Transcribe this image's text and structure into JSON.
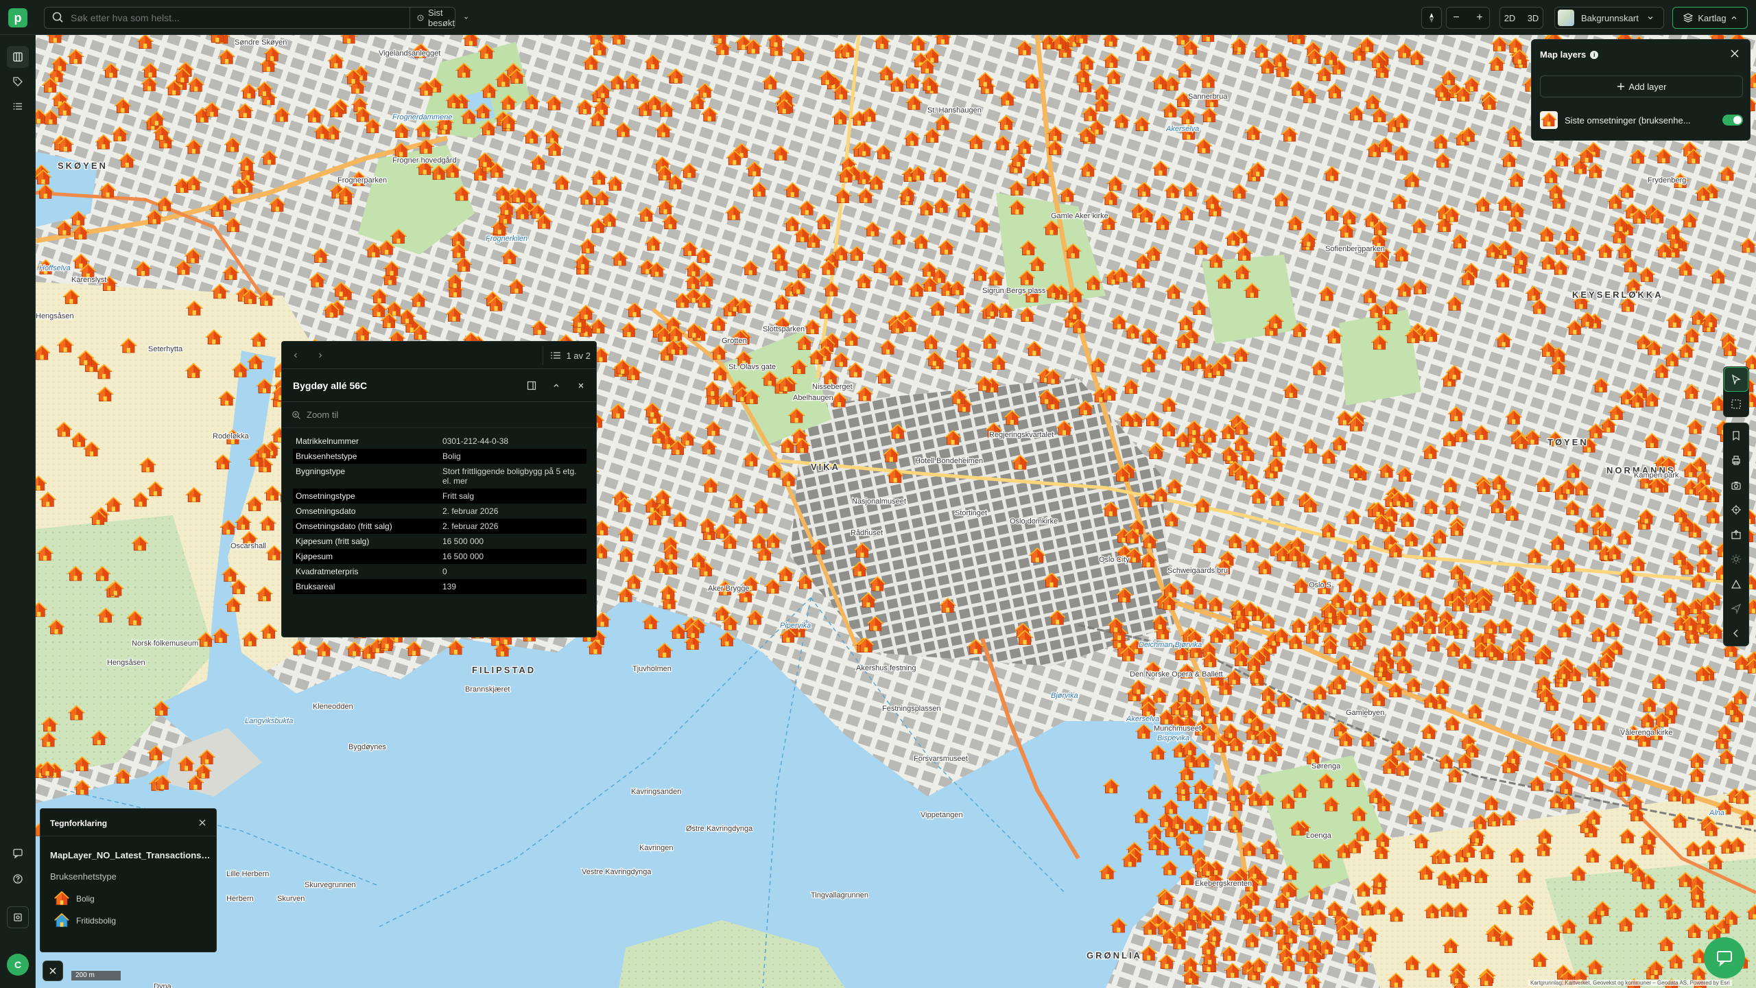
{
  "app": {
    "logo_letter": "p"
  },
  "search": {
    "placeholder": "Søk etter hva som helst...",
    "recent_label": "Sist besøkt"
  },
  "toolbar": {
    "compass_icon": "compass-icon",
    "zoom_out_label": "−",
    "zoom_in_label": "+",
    "view_2d_label": "2D",
    "view_3d_label": "3D",
    "basemap_label": "Bakgrunnskart",
    "layers_label": "Kartlag"
  },
  "sidebar": {
    "avatar_initial": "C"
  },
  "map_layers_panel": {
    "title": "Map layers",
    "add_layer_label": "Add layer",
    "layers": [
      {
        "name": "Siste omsetninger (bruksenhe...",
        "visible": true
      }
    ]
  },
  "popup": {
    "pager": "1 av 2",
    "title": "Bygdøy allé 56C",
    "zoom_to_label": "Zoom til",
    "attributes": [
      {
        "key": "Matrikkelnummer",
        "value": "0301-212-44-0-38"
      },
      {
        "key": "Bruksenhetstype",
        "value": "Bolig"
      },
      {
        "key": "Bygningstype",
        "value": "Stort frittliggende boligbygg på 5 etg. el. mer"
      },
      {
        "key": "Omsetningstype",
        "value": "Fritt salg"
      },
      {
        "key": "Omsetningsdato",
        "value": "2. februar 2026"
      },
      {
        "key": "Omsetningsdato (fritt salg)",
        "value": "2. februar 2026"
      },
      {
        "key": "Kjøpesum (fritt salg)",
        "value": "16 500 000"
      },
      {
        "key": "Kjøpesum",
        "value": "16 500 000"
      },
      {
        "key": "Kvadratmeterpris",
        "value": "0"
      },
      {
        "key": "Bruksareal",
        "value": "139"
      }
    ]
  },
  "legend": {
    "title": "Tegnforklaring",
    "layer_name": "MapLayer_NO_Latest_Transactions_...",
    "field_name": "Bruksenhetstype",
    "items": [
      {
        "label": "Bolig",
        "color": "#f26b1d"
      },
      {
        "label": "Fritidsbolig",
        "color": "#3aa0d8"
      }
    ]
  },
  "scale": {
    "label": "200 m"
  },
  "attribution": "Kartgrunnlag: Kartverket, Geovekst og kommuner – Geodata AS, Powered by Esri",
  "map_labels": [
    {
      "text": "Søndre Skøyen"
    },
    {
      "text": "Vigelandsanlegget"
    },
    {
      "text": "SKØYEN"
    },
    {
      "text": "Frognerdammene"
    },
    {
      "text": "Frogner hovedgård"
    },
    {
      "text": "Frognerkilen"
    },
    {
      "text": "Hoffselva"
    },
    {
      "text": "Karenslyst"
    },
    {
      "text": "Hengsåsen"
    },
    {
      "text": "Frognerparken"
    },
    {
      "text": "Seterhytta"
    },
    {
      "text": "Rodeløkka"
    },
    {
      "text": "Oscarshall"
    },
    {
      "text": "Norsk folkemuseum"
    },
    {
      "text": "Hengsåsen"
    },
    {
      "text": "Langviksbukta"
    },
    {
      "text": "Kleneodden"
    },
    {
      "text": "Bygdøynes"
    },
    {
      "text": "FILIPSTAD"
    },
    {
      "text": "Brannskjæret"
    },
    {
      "text": "Tjuvholmen"
    },
    {
      "text": "Pipervika"
    },
    {
      "text": "Aker Brygge"
    },
    {
      "text": "Akershus festning"
    },
    {
      "text": "Festningsplassen"
    },
    {
      "text": "Forsvarsmuseet"
    },
    {
      "text": "Vippetangen"
    },
    {
      "text": "Kavringsanden"
    },
    {
      "text": "Østre Kavringdynga"
    },
    {
      "text": "Kavringen"
    },
    {
      "text": "Vestre Kavringdynga"
    },
    {
      "text": "Tingvallagrunnen"
    },
    {
      "text": "Lille Herbern"
    },
    {
      "text": "Skurvegrunnen"
    },
    {
      "text": "Herbern"
    },
    {
      "text": "Skurven"
    },
    {
      "text": "Dyna"
    },
    {
      "text": "Akerselva"
    },
    {
      "text": "St. Hanshaugen"
    },
    {
      "text": "Sannerbrua"
    },
    {
      "text": "Frydenberg"
    },
    {
      "text": "KEYSERLØKKA"
    },
    {
      "text": "TØYEN"
    },
    {
      "text": "NORMANNS"
    },
    {
      "text": "GRØNLIA"
    },
    {
      "text": "Bispevika"
    },
    {
      "text": "Den Norske Opera & Ballett"
    },
    {
      "text": "Munchmuseet"
    },
    {
      "text": "Oslo City"
    },
    {
      "text": "Oslo domkirke"
    },
    {
      "text": "Rådhuset"
    },
    {
      "text": "Nasjonalmuseet"
    },
    {
      "text": "Slottsparken"
    },
    {
      "text": "Regjeringskvartalet"
    },
    {
      "text": "Nisseberget"
    },
    {
      "text": "Abelhaugen"
    },
    {
      "text": "Gamlebyen"
    },
    {
      "text": "Sørenga"
    },
    {
      "text": "Loenga"
    },
    {
      "text": "Ekebergskrenten"
    },
    {
      "text": "Vålerenga kirke"
    },
    {
      "text": "Sofienbergparken"
    },
    {
      "text": "Kampen park"
    },
    {
      "text": "Deichman Bjørvika"
    },
    {
      "text": "Bjørvika"
    },
    {
      "text": "Schweigaards bru"
    },
    {
      "text": "Oslo S"
    },
    {
      "text": "Stortinget"
    },
    {
      "text": "Hotell Bondeheimen"
    },
    {
      "text": "Sigrun Bergs plass"
    },
    {
      "text": "St. Olavs gate"
    },
    {
      "text": "Grotten"
    },
    {
      "text": "VIKA"
    },
    {
      "text": "Gamle Aker kirke"
    },
    {
      "text": "Akerselva"
    },
    {
      "text": "Alna"
    }
  ]
}
